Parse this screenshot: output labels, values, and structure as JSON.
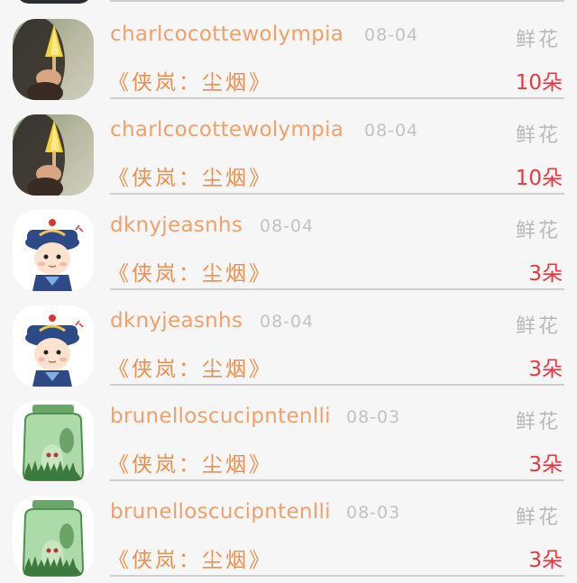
{
  "records": [
    {
      "avatar": "popsicle-avatar",
      "username": "charlcocottewolympia",
      "date": "08-04",
      "gift_type": "鲜花",
      "title": "《侠岚：尘烟》",
      "amount": "10朵"
    },
    {
      "avatar": "popsicle-avatar",
      "username": "charlcocottewolympia",
      "date": "08-04",
      "gift_type": "鲜花",
      "title": "《侠岚：尘烟》",
      "amount": "10朵"
    },
    {
      "avatar": "qing-official-cartoon-avatar",
      "username": "dknyjeasnhs",
      "date": "08-04",
      "gift_type": "鲜花",
      "title": "《侠岚：尘烟》",
      "amount": "3朵"
    },
    {
      "avatar": "qing-official-cartoon-avatar",
      "username": "dknyjeasnhs",
      "date": "08-04",
      "gift_type": "鲜花",
      "title": "《侠岚：尘烟》",
      "amount": "3朵"
    },
    {
      "avatar": "green-jar-ghost-avatar",
      "username": "brunelloscucipntenlli",
      "date": "08-03",
      "gift_type": "鲜花",
      "title": "《侠岚：尘烟》",
      "amount": "3朵"
    },
    {
      "avatar": "green-jar-ghost-avatar",
      "username": "brunelloscucipntenlli",
      "date": "08-03",
      "gift_type": "鲜花",
      "title": "《侠岚：尘烟》",
      "amount": "3朵"
    }
  ],
  "colors": {
    "username": "#f0a06b",
    "title": "#ef8f4e",
    "amount": "#e8383d",
    "meta": "#c2c2c2",
    "background": "#f7f6f6"
  }
}
